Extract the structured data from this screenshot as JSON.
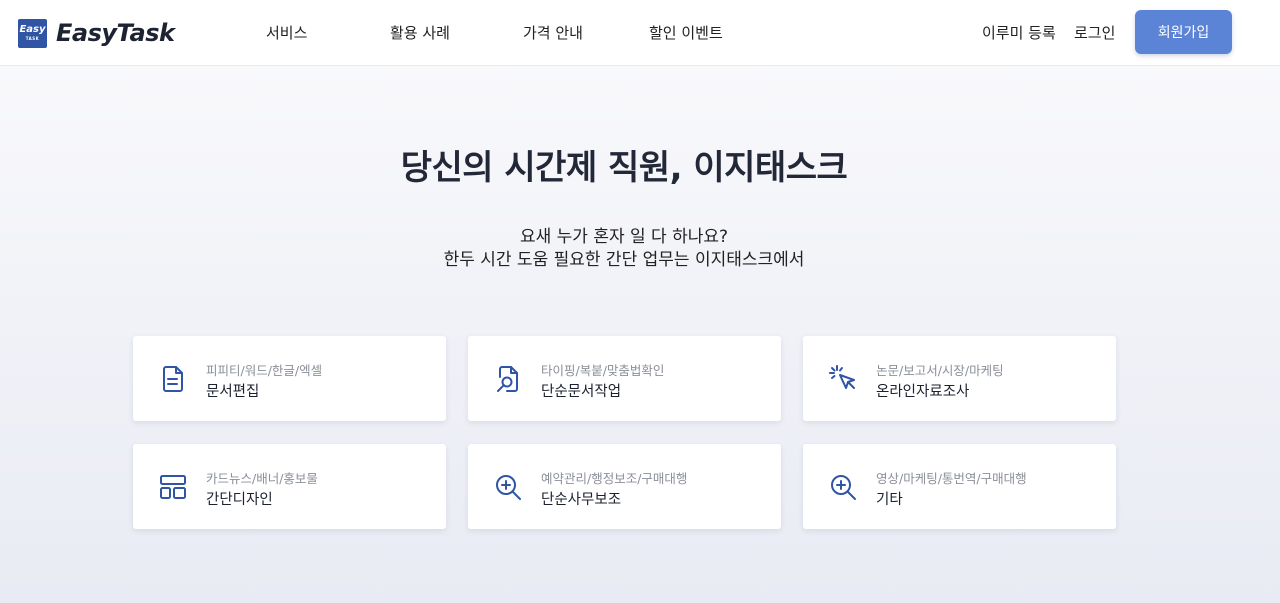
{
  "brand": {
    "badge_main": "Easy",
    "badge_small": "TASK",
    "name": "EasyTask",
    "accent": "#2f55a4"
  },
  "nav": {
    "items": [
      {
        "label": "서비스"
      },
      {
        "label": "활용 사례"
      },
      {
        "label": "가격 안내"
      },
      {
        "label": "할인 이벤트"
      }
    ],
    "register_label": "이루미 등록",
    "login_label": "로그인",
    "signup_label": "회원가입",
    "signup_color": "#5c84d6"
  },
  "hero": {
    "title": "당신의 시간제 직원, 이지태스크",
    "line1": "요새 누가 혼자 일 다 하나요?",
    "line2": "한두 시간 도움 필요한 간단 업무는 이지태스크에서"
  },
  "services": [
    {
      "sub": "피피티/워드/한글/엑셀",
      "label": "문서편집",
      "icon": "document-icon"
    },
    {
      "sub": "타이핑/복붙/맞춤법확인",
      "label": "단순문서작업",
      "icon": "file-search-icon"
    },
    {
      "sub": "논문/보고서/시장/마케팅",
      "label": "온라인자료조사",
      "icon": "cursor-click-icon"
    },
    {
      "sub": "카드뉴스/배너/홍보물",
      "label": "간단디자인",
      "icon": "layout-icon"
    },
    {
      "sub": "예약관리/행정보조/구매대행",
      "label": "단순사무보조",
      "icon": "zoom-in-icon"
    },
    {
      "sub": "영상/마케팅/통번역/구매대행",
      "label": "기타",
      "icon": "zoom-in-icon"
    }
  ]
}
